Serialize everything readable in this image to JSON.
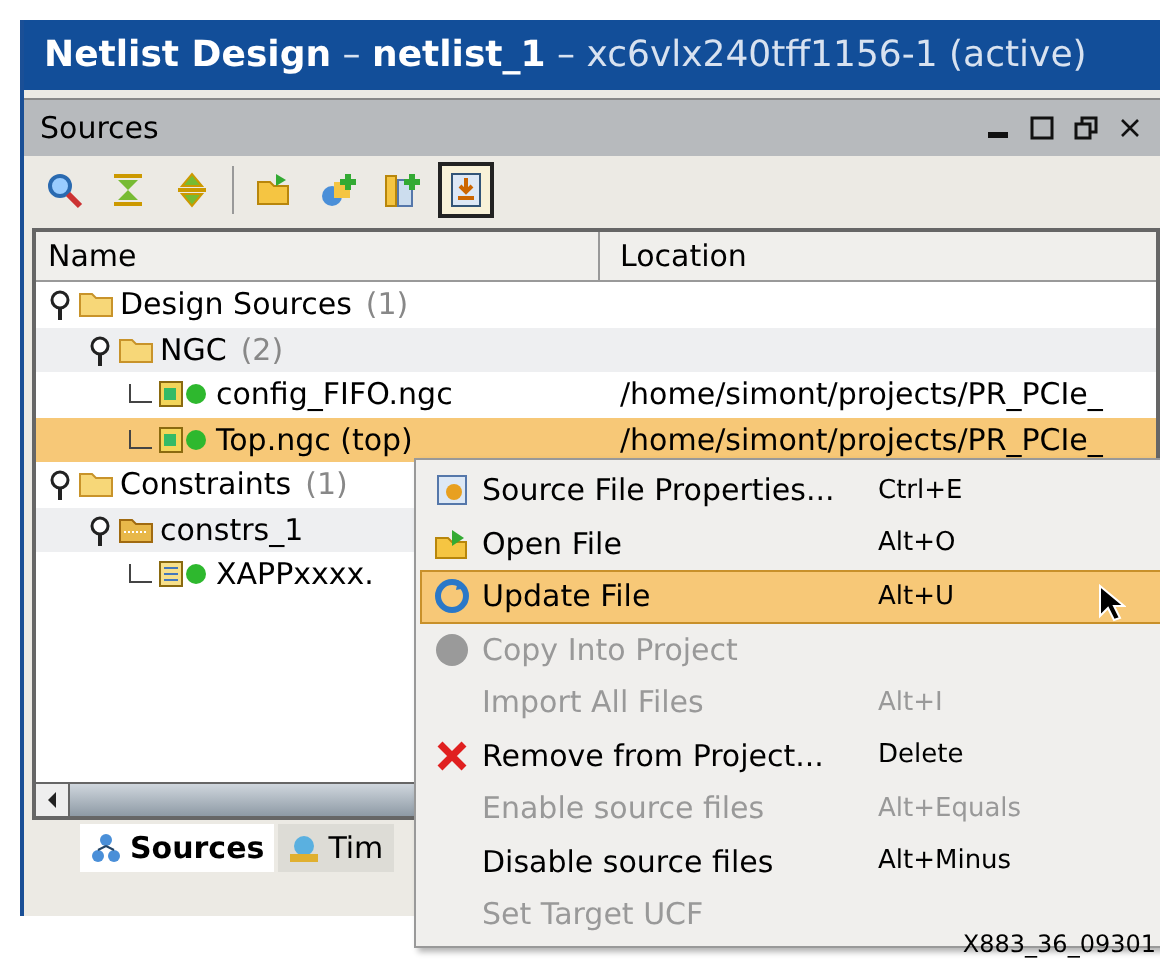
{
  "window": {
    "title_parts": [
      {
        "text": "Netlist Design",
        "bold": true
      },
      {
        "text": " – ",
        "bold": false
      },
      {
        "text": "netlist_1",
        "bold": true
      },
      {
        "text": " – xc6vlx240tff1156-1 (active)",
        "bold": false
      }
    ]
  },
  "panel": {
    "title": "Sources"
  },
  "toolbar": [
    {
      "kind": "search",
      "selected": false
    },
    {
      "kind": "collapse",
      "selected": false
    },
    {
      "kind": "expand",
      "selected": false
    },
    {
      "kind": "open",
      "selected": false
    },
    {
      "kind": "add",
      "selected": false
    },
    {
      "kind": "add-list",
      "selected": false
    },
    {
      "kind": "import",
      "selected": true
    }
  ],
  "table": {
    "columns": [
      "Name",
      "Location"
    ],
    "tree": [
      {
        "label": "Design Sources",
        "count": "(1)",
        "kind": "folder",
        "expanded": true,
        "selected": false,
        "children": [
          {
            "label": "NGC",
            "count": "(2)",
            "kind": "folder",
            "expanded": true,
            "selected": false,
            "children": [
              {
                "label": "config_FIFO.ngc",
                "kind": "netlist",
                "location": "/home/simont/projects/PR_PCIe_",
                "selected": false
              },
              {
                "label": "Top.ngc (top)",
                "kind": "netlist",
                "location": "/home/simont/projects/PR_PCIe_",
                "selected": true
              }
            ]
          }
        ]
      },
      {
        "label": "Constraints",
        "count": "(1)",
        "kind": "folder",
        "expanded": true,
        "selected": false,
        "children": [
          {
            "label": "constrs_1",
            "kind": "constraint-set",
            "expanded": true,
            "selected": false,
            "children": [
              {
                "label": "XAPPxxxx.",
                "kind": "constraint-file",
                "selected": false
              }
            ]
          }
        ]
      }
    ]
  },
  "tabs": [
    {
      "label": "Sources",
      "kind": "sources",
      "selected": true
    },
    {
      "label": "Tim",
      "kind": "timing",
      "selected": false
    }
  ],
  "menu": [
    {
      "label": "Source File Properties...",
      "shortcut": "Ctrl+E",
      "kind": "properties",
      "disabled": false,
      "selected": false
    },
    {
      "label": "Open File",
      "shortcut": "Alt+O",
      "kind": "open",
      "disabled": false,
      "selected": false
    },
    {
      "label": "Update File",
      "shortcut": "Alt+U",
      "kind": "refresh",
      "disabled": false,
      "selected": true
    },
    {
      "label": "Copy Into Project",
      "kind": "circle",
      "disabled": true,
      "selected": false
    },
    {
      "label": "Import All Files",
      "shortcut": "Alt+I",
      "disabled": true,
      "selected": false
    },
    {
      "label": "Remove from Project...",
      "shortcut": "Delete",
      "kind": "remove",
      "disabled": false,
      "selected": false
    },
    {
      "label": "Enable source files",
      "shortcut": "Alt+Equals",
      "disabled": true,
      "selected": false
    },
    {
      "label": "Disable source files",
      "shortcut": "Alt+Minus",
      "disabled": false,
      "selected": false
    },
    {
      "label": "Set Target UCF",
      "disabled": true,
      "selected": false
    }
  ],
  "caption": "X883_36_09301"
}
